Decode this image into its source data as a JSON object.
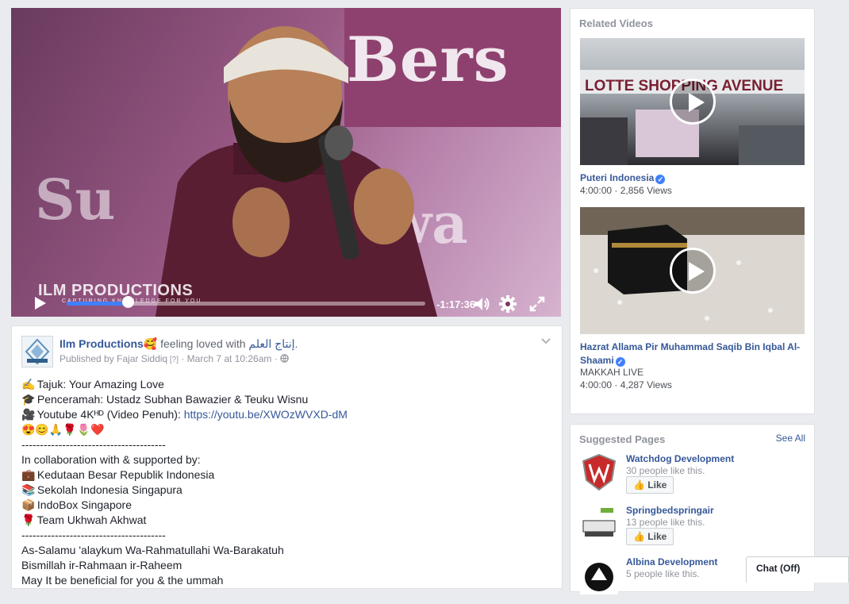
{
  "video": {
    "watermark_title": "ILM PRODUCTIONS",
    "watermark_sub": "CAPTURING KNOWLEDGE FOR YOU",
    "banner_word": "Bers",
    "banner_left": "Su",
    "banner_right": "wa",
    "time_remaining": "-1:17:36",
    "progress": 0.17
  },
  "post": {
    "page_name": "Ilm Productions",
    "feeling_emoji": "🥰",
    "feeling_text": " feeling loved with ",
    "feeling_target": "إنتاج العلم",
    "feeling_end": ".",
    "published_by": "Published by Fajar Siddiq",
    "editor_mark": " [?]",
    "sep": " · ",
    "date": "March 7 at 10:26am",
    "lines": [
      {
        "emoji": "✍",
        "text": "Tajuk: Your Amazing Love"
      },
      {
        "emoji": "🎓",
        "text": "Penceramah: Ustadz Subhan Bawazier & Teuku Wisnu"
      },
      {
        "emoji": "🎥",
        "text": "Youtube 4Kᴴᴰ (Video Penuh): ",
        "link": "https://youtu.be/XWOzWVXD-dM"
      },
      {
        "emoji": "",
        "text": "😍😊🙏🌹🌷❤️"
      },
      {
        "emoji": "",
        "text": "---------------------------------------"
      },
      {
        "emoji": "",
        "text": "In collaboration with & supported by:"
      },
      {
        "emoji": "💼",
        "text": "Kedutaan Besar Republik Indonesia"
      },
      {
        "emoji": "📚",
        "text": "Sekolah Indonesia Singapura"
      },
      {
        "emoji": "📦",
        "text": "IndoBox Singapore"
      },
      {
        "emoji": "🌹",
        "text": "Team Ukhwah Akhwat"
      },
      {
        "emoji": "",
        "text": "---------------------------------------"
      },
      {
        "emoji": "",
        "text": "As-Salamu 'alaykum Wa-Rahmatullahi Wa-Barakatuh"
      },
      {
        "emoji": "",
        "text": "Bismillah ir-Rahmaan ir-Raheem"
      },
      {
        "emoji": "",
        "text": "May It be beneficial for you & the ummah"
      }
    ]
  },
  "related": {
    "title": "Related Videos",
    "items": [
      {
        "title": "Puteri Indonesia",
        "verified": true,
        "meta": "4:00:00 · 2,856 Views",
        "thumb_text": "LOTTE SHOPPING AVENUE"
      },
      {
        "title": "Hazrat Allama Pir Muhammad Saqib Bin Iqbal Al-Shaami",
        "verified": true,
        "subtitle": "MAKKAH LIVE",
        "meta": "4:00:00 · 4,287 Views"
      }
    ]
  },
  "suggested": {
    "title": "Suggested Pages",
    "see_all": "See All",
    "like_label": "Like",
    "items": [
      {
        "name": "Watchdog Development",
        "likes": "30 people like this."
      },
      {
        "name": "Springbedspringair",
        "likes": "13 people like this."
      },
      {
        "name": "Albina Development",
        "likes": "5 people like this."
      }
    ]
  },
  "chat": {
    "label": "Chat (Off)"
  }
}
